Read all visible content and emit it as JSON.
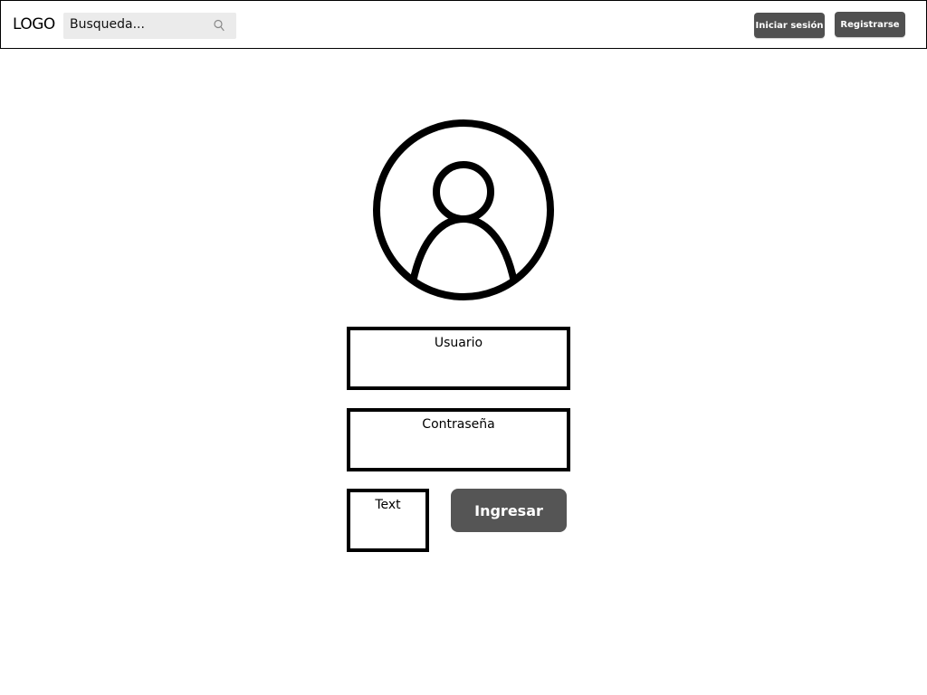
{
  "header": {
    "logo": "LOGO",
    "search": {
      "placeholder": "Busqueda...",
      "icon": "search-icon"
    },
    "login_label": "Iniciar sesión",
    "register_label": "Registrarse"
  },
  "form": {
    "avatar_icon": "user-avatar-icon",
    "username_label": "Usuario",
    "password_label": "Contraseña",
    "text_label": "Text",
    "submit_label": "Ingresar"
  },
  "colors": {
    "button_dark": "#505050",
    "search_bg": "#ebebeb",
    "border": "#000000"
  }
}
